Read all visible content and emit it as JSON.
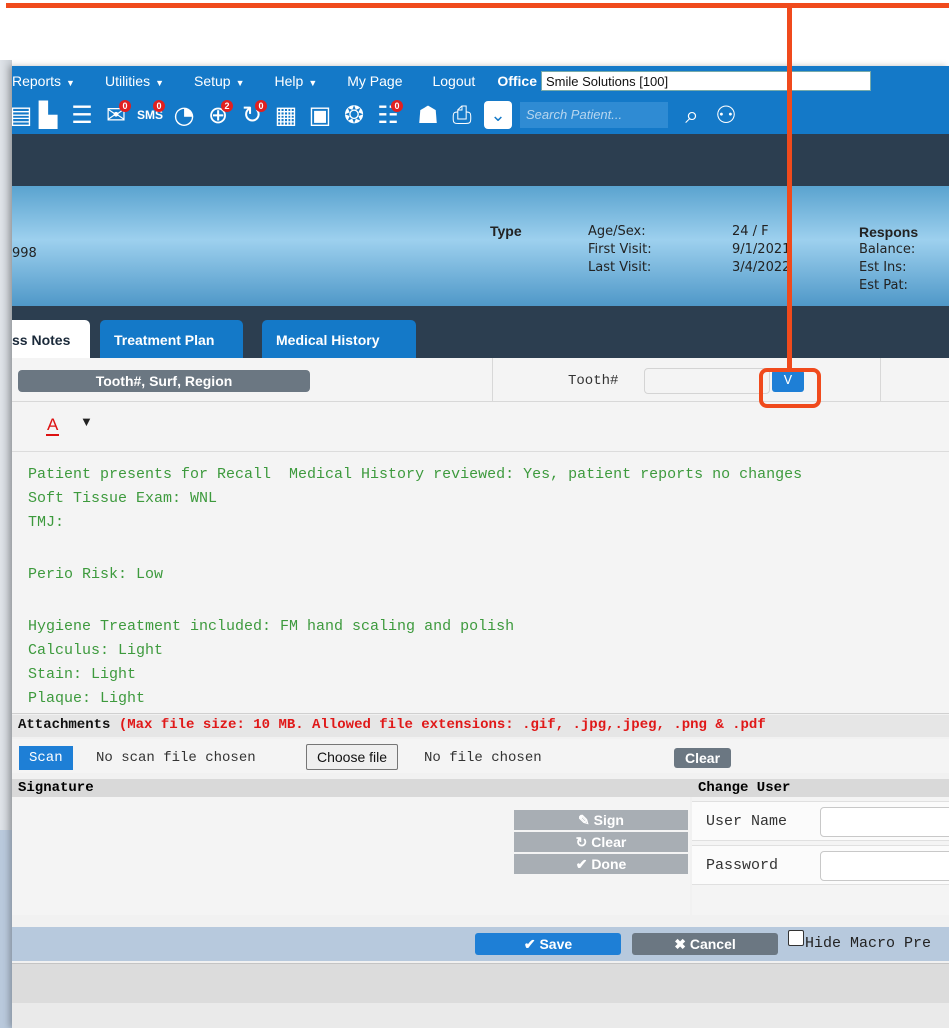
{
  "menu": {
    "items": [
      "Reports",
      "Utilities",
      "Setup",
      "Help",
      "My Page",
      "Logout"
    ],
    "office_label": "Office",
    "office_value": "Smile Solutions [100]"
  },
  "toolbar": {
    "badges": {
      "messages": "0",
      "sms": "0",
      "web": "2",
      "recall": "0",
      "forms": "0"
    },
    "search_placeholder": "Search Patient..."
  },
  "patient": {
    "id_fragment": "998",
    "type_label": "Type",
    "labels": [
      "Age/Sex:",
      "First Visit:",
      "Last Visit:"
    ],
    "values": [
      "24 / F",
      "9/1/2021",
      "3/4/2022"
    ],
    "responsible_head": "Respons",
    "responsible_labels": [
      "Balance:",
      "Est Ins:",
      "Est Pat:"
    ]
  },
  "tabs": [
    "ss Notes",
    "Treatment Plan",
    "Medical History"
  ],
  "tooth_row": {
    "region_button": "Tooth#, Surf, Region",
    "tooth_label": "Tooth#",
    "v_button": "V"
  },
  "editor": {
    "font_color_glyph": "A",
    "lines": [
      "Patient presents for Recall  Medical History reviewed: Yes, patient reports no changes",
      "Soft Tissue Exam: WNL",
      "TMJ:",
      "",
      "Perio Risk: Low",
      "",
      "Hygiene Treatment included: FM hand scaling and polish",
      "Calculus: Light",
      "Stain: Light",
      "Plaque: Light"
    ]
  },
  "attachments": {
    "label": "Attachments",
    "note": "(Max file size: 10 MB. Allowed file extensions: .gif, .jpg,.jpeg, .png & .pdf",
    "scan_button": "Scan",
    "scan_status": "No scan file chosen",
    "choose_button": "Choose file",
    "file_status": "No file chosen",
    "clear_button": "Clear"
  },
  "signature": {
    "header": "Signature",
    "sign": "Sign",
    "clear": "Clear",
    "done": "Done"
  },
  "change_user": {
    "header": "Change User",
    "username_label": "User Name",
    "password_label": "Password"
  },
  "actions": {
    "save": "Save",
    "cancel": "Cancel",
    "hide_macro": "Hide Macro Pre"
  },
  "colors": {
    "menu_blue": "#1479c8",
    "dark_band": "#2c3e50",
    "note_green": "#3d9a3d",
    "warning_red": "#e01818",
    "callout_orange": "#f04a1c"
  }
}
